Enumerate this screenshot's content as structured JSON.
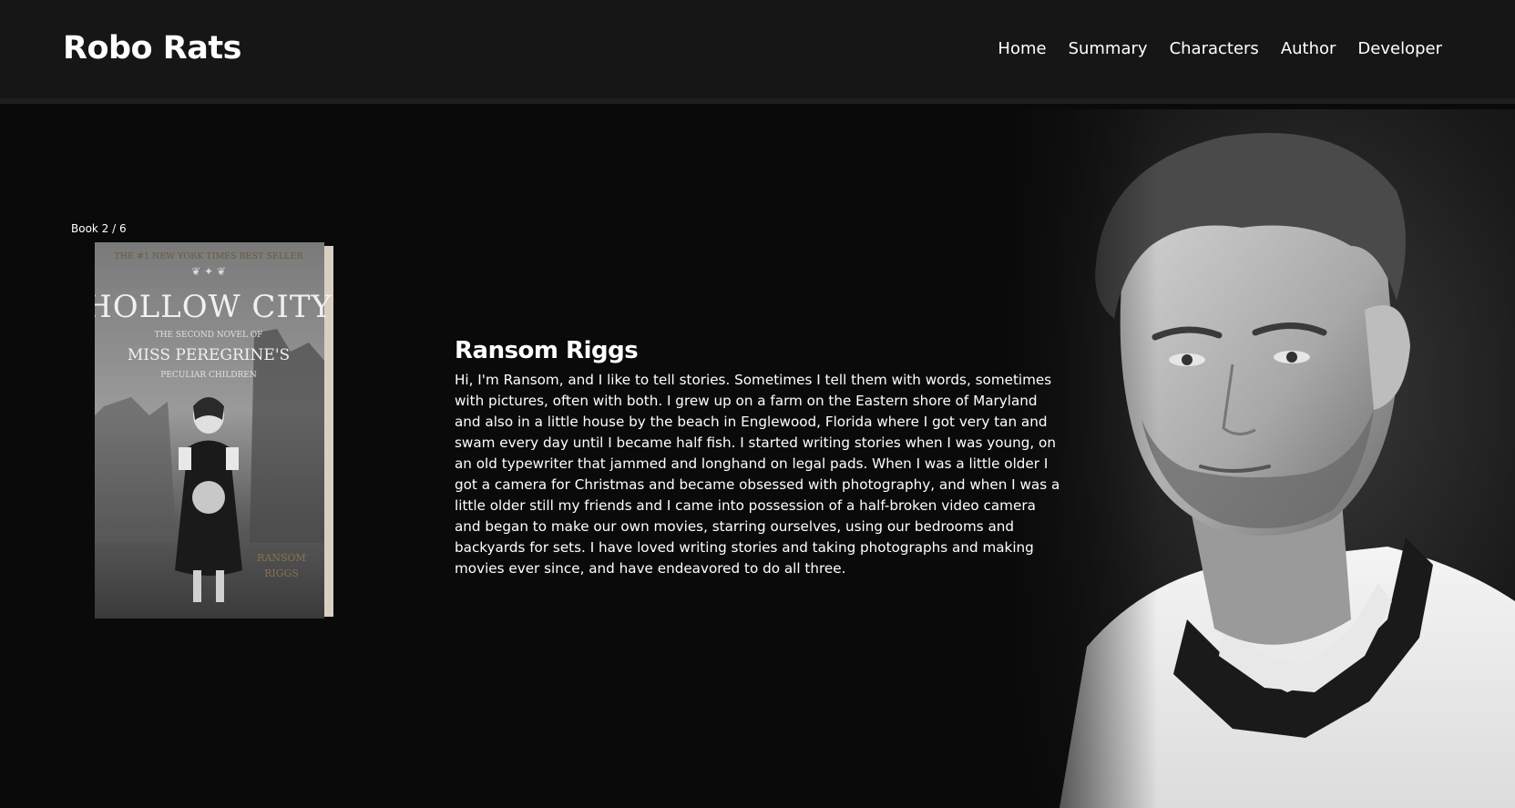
{
  "header": {
    "brand": "Robo Rats",
    "nav": [
      "Home",
      "Summary",
      "Characters",
      "Author",
      "Developer"
    ]
  },
  "book": {
    "counter": "Book 2 / 6",
    "cover": {
      "top_line": "THE #1 NEW YORK TIMES BEST SELLER",
      "title": "HOLLOW CITY",
      "subtitle_1": "THE SECOND NOVEL OF",
      "subtitle_2": "MISS PEREGRINE'S",
      "subtitle_3": "PECULIAR CHILDREN",
      "author_1": "RANSOM",
      "author_2": "RIGGS"
    }
  },
  "author": {
    "name": "Ransom Riggs",
    "bio": "Hi, I'm Ransom, and I like to tell stories. Sometimes I tell them with words, sometimes with pictures, often with both. I grew up on a farm on the Eastern shore of Maryland and also in a little house by the beach in Englewood, Florida where I got very tan and swam every day until I became half fish. I started writing stories when I was young, on an old typewriter that jammed and longhand on legal pads. When I was a little older I got a camera for Christmas and became obsessed with photography, and when I was a little older still my friends and I came into possession of a half-broken video camera and began to make our own movies, starring ourselves, using our bedrooms and backyards for sets. I have loved writing stories and taking photographs and making movies ever since, and have endeavored to do all three."
  }
}
